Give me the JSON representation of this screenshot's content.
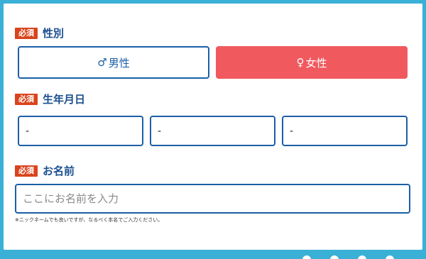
{
  "gender": {
    "required_badge": "必須",
    "label": "性別",
    "male": {
      "symbol": "♂",
      "label": "男性"
    },
    "female": {
      "symbol": "♀",
      "label": "女性"
    },
    "selected": "female"
  },
  "birthdate": {
    "required_badge": "必須",
    "label": "生年月日",
    "year_value": "-",
    "month_value": "-",
    "day_value": "-"
  },
  "name": {
    "required_badge": "必須",
    "label": "お名前",
    "placeholder": "ここにお名前を入力",
    "value": "",
    "note": "※ニックネームでも良いですが、なるべく本名でご入力ください。"
  },
  "pager": {
    "dot_count": 4
  },
  "colors": {
    "background": "#3bb0d6",
    "badge": "#d9441c",
    "label": "#1b4f8f",
    "border": "#1b5fa6",
    "female_selected": "#f05a5f"
  }
}
